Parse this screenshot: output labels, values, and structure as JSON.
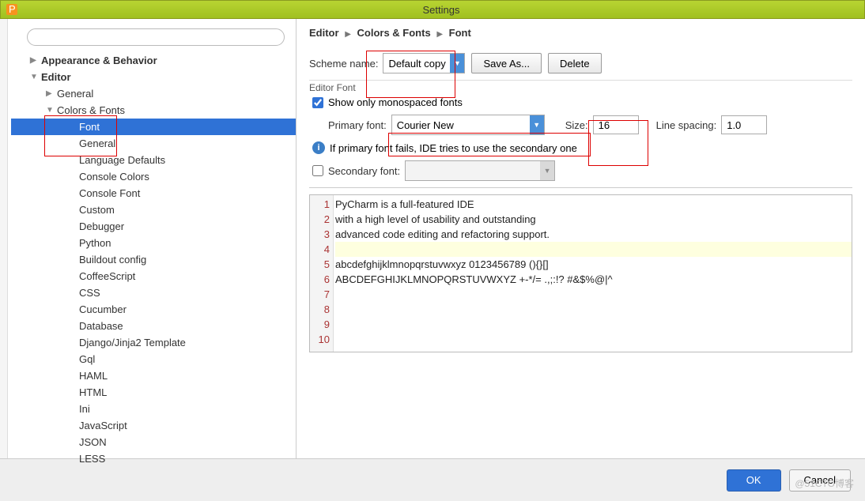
{
  "window": {
    "title": "Settings"
  },
  "search": {
    "placeholder": ""
  },
  "tree": {
    "items": [
      {
        "label": "Appearance & Behavior",
        "level": 1,
        "bold": true,
        "arrow": "▶"
      },
      {
        "label": "Editor",
        "level": 1,
        "bold": true,
        "arrow": "▼"
      },
      {
        "label": "General",
        "level": 2,
        "arrow": "▶"
      },
      {
        "label": "Colors & Fonts",
        "level": 2,
        "arrow": "▼"
      },
      {
        "label": "Font",
        "level": 3,
        "selected": true
      },
      {
        "label": "General",
        "level": 3
      },
      {
        "label": "Language Defaults",
        "level": 3
      },
      {
        "label": "Console Colors",
        "level": 3
      },
      {
        "label": "Console Font",
        "level": 3
      },
      {
        "label": "Custom",
        "level": 3
      },
      {
        "label": "Debugger",
        "level": 3
      },
      {
        "label": "Python",
        "level": 3
      },
      {
        "label": "Buildout config",
        "level": 3
      },
      {
        "label": "CoffeeScript",
        "level": 3
      },
      {
        "label": "CSS",
        "level": 3
      },
      {
        "label": "Cucumber",
        "level": 3
      },
      {
        "label": "Database",
        "level": 3
      },
      {
        "label": "Django/Jinja2 Template",
        "level": 3
      },
      {
        "label": "Gql",
        "level": 3
      },
      {
        "label": "HAML",
        "level": 3
      },
      {
        "label": "HTML",
        "level": 3
      },
      {
        "label": "Ini",
        "level": 3
      },
      {
        "label": "JavaScript",
        "level": 3
      },
      {
        "label": "JSON",
        "level": 3
      },
      {
        "label": "LESS",
        "level": 3
      }
    ]
  },
  "breadcrumb": {
    "a": "Editor",
    "b": "Colors & Fonts",
    "c": "Font"
  },
  "scheme": {
    "label": "Scheme name:",
    "value": "Default copy",
    "saveAs": "Save As...",
    "delete": "Delete"
  },
  "editorFont": {
    "section": "Editor Font",
    "showMono": "Show only monospaced fonts",
    "primaryLabel": "Primary font:",
    "primaryValue": "Courier New",
    "sizeLabel": "Size:",
    "sizeValue": "16",
    "lineSpacingLabel": "Line spacing:",
    "lineSpacingValue": "1.0",
    "fallbackInfo": "If primary font fails, IDE tries to use the secondary one",
    "secondaryLabel": "Secondary font:",
    "secondaryValue": ""
  },
  "preview": {
    "lines": [
      "PyCharm is a full-featured IDE",
      "with a high level of usability and outstanding",
      "advanced code editing and refactoring support.",
      "",
      "abcdefghijklmnopqrstuvwxyz 0123456789 (){}[]",
      "ABCDEFGHIJKLMNOPQRSTUVWXYZ +-*/= .,;:!? #&$%@|^",
      "",
      "",
      "",
      ""
    ]
  },
  "buttons": {
    "ok": "OK",
    "cancel": "Cancel"
  },
  "watermark": "@51CTO博客"
}
